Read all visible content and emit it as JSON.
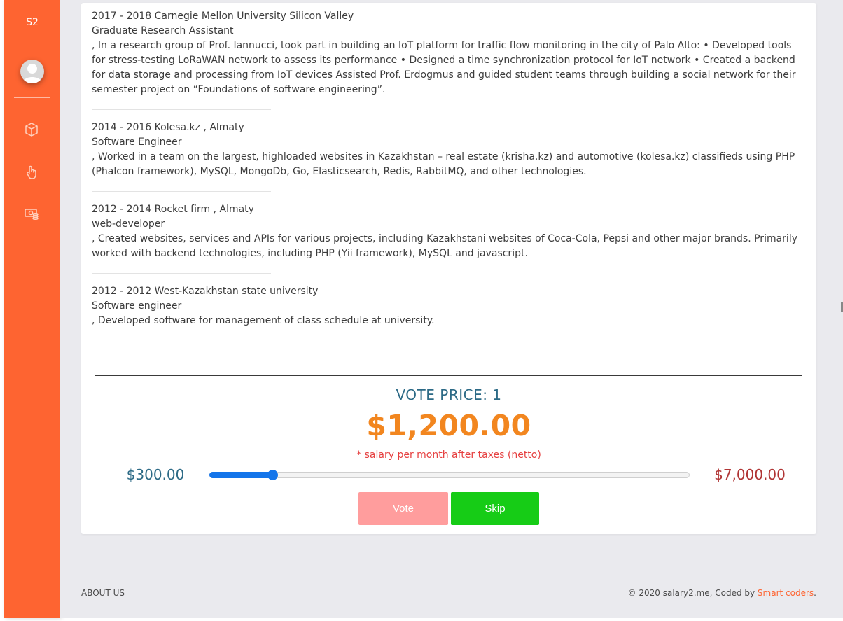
{
  "sidebar": {
    "brand": "S2",
    "icons": [
      "box-icon",
      "hand-pointer-icon",
      "money-icon"
    ],
    "accent_color": "#fe6431"
  },
  "experience": [
    {
      "period": "2017 - 2018 Carnegie Mellon University Silicon Valley",
      "role": "Graduate Research Assistant",
      "description": ", In a research group of Prof. Iannucci, took part in building an IoT platform for traffic flow monitoring in the city of Palo Alto: • Developed tools for stress-testing LoRaWAN network to assess its performance • Designed a time synchronization protocol for IoT network • Created a backend for data storage and processing from IoT devices Assisted Prof. Erdogmus and guided student teams through building a social network for their semester project on “Foundations of software engineering”."
    },
    {
      "period": "2014 - 2016 Kolesa.kz , Almaty",
      "role": "Software Engineer",
      "description": ", Worked in a team on the largest, highloaded websites in Kazakhstan – real estate (krisha.kz) and automotive (kolesa.kz) classifieds using PHP (Phalcon framework), MySQL, MongoDb, Go, Elasticsearch, Redis, RabbitMQ, and other technologies."
    },
    {
      "period": "2012 - 2014 Rocket firm , Almaty",
      "role": "web-developer",
      "description": ", Created websites, services and APIs for various projects, including Kazakhstani websites of Coca-Cola, Pepsi and other major brands. Primarily worked with backend technologies, including PHP (Yii framework), MySQL and javascript."
    },
    {
      "period": "2012 - 2012 West-Kazakhstan state university",
      "role": "Software engineer",
      "description": ", Developed software for management of class schedule at university."
    }
  ],
  "vote": {
    "price_label": "VOTE PRICE: 1",
    "salary": "$1,200.00",
    "note": "* salary per month after taxes (netto)",
    "min": "$300.00",
    "max": "$7,000.00",
    "slider_value_fraction": 0.13,
    "vote_label": "Vote",
    "skip_label": "Skip"
  },
  "footer": {
    "about": "ABOUT US",
    "copyright": "© 2020 salary2.me, Coded by ",
    "credit_link": "Smart coders",
    "credit_end": "."
  }
}
